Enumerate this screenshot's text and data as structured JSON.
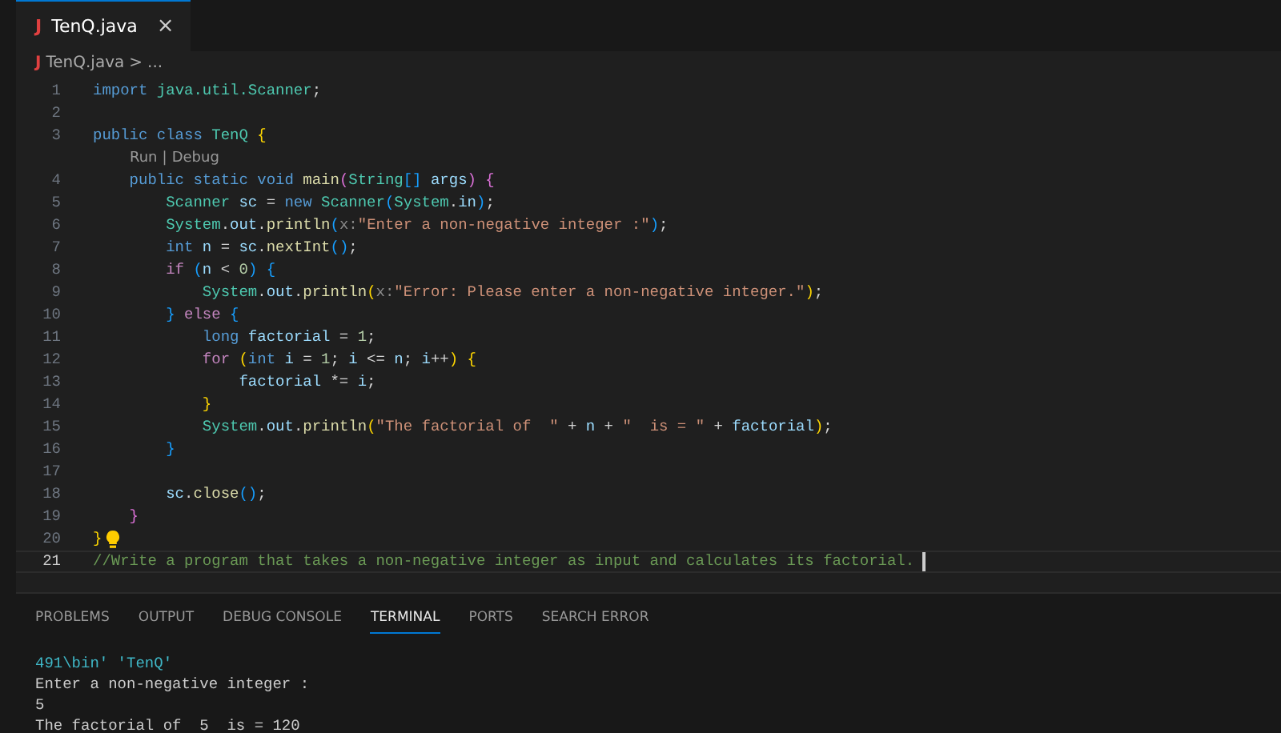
{
  "editor_tabs": [
    {
      "label": "TenQ.java",
      "icon": "J",
      "close": "×",
      "selected": true
    }
  ],
  "breadcrumb": {
    "icon": "J",
    "file": "TenQ.java",
    "separator": ">",
    "rest": "..."
  },
  "lines": [
    {
      "kind": "code",
      "number": "1",
      "current": false,
      "tokens": [
        {
          "text": "import ",
          "kind": "kw"
        },
        {
          "text": "java.util.Scanner",
          "kind": "type"
        },
        {
          "text": ";",
          "kind": "p"
        }
      ]
    },
    {
      "kind": "code",
      "number": "2",
      "current": false
    },
    {
      "kind": "code",
      "number": "3",
      "current": false,
      "tokens": [
        {
          "text": "public class ",
          "kind": "kw"
        },
        {
          "text": "TenQ ",
          "kind": "type"
        },
        {
          "text": "{",
          "kind": "b1"
        }
      ]
    },
    {
      "kind": "codelens",
      "links": [
        "Run",
        "Debug"
      ],
      "separator": "|"
    },
    {
      "kind": "code",
      "number": "4",
      "current": false,
      "tokens": [
        {
          "text": "    public static void ",
          "kind": "kw"
        },
        {
          "text": "main",
          "kind": "fn"
        },
        {
          "text": "(",
          "kind": "b2"
        },
        {
          "text": "String",
          "kind": "type"
        },
        {
          "text": "[] ",
          "kind": "b3"
        },
        {
          "text": "args",
          "kind": "var"
        },
        {
          "text": ") {",
          "kind": "b2"
        }
      ]
    },
    {
      "kind": "code",
      "number": "5",
      "current": false,
      "tokens": [
        {
          "text": "        Scanner ",
          "kind": "type"
        },
        {
          "text": "sc",
          "kind": "var"
        },
        {
          "text": " = ",
          "kind": "p"
        },
        {
          "text": "new ",
          "kind": "kw"
        },
        {
          "text": "Scanner",
          "kind": "type"
        },
        {
          "text": "(",
          "kind": "b3"
        },
        {
          "text": "System",
          "kind": "type"
        },
        {
          "text": ".",
          "kind": "p"
        },
        {
          "text": "in",
          "kind": "var"
        },
        {
          "text": ")",
          "kind": "b3"
        },
        {
          "text": ";",
          "kind": "p"
        }
      ]
    },
    {
      "kind": "code",
      "number": "6",
      "current": false,
      "tokens": [
        {
          "text": "        System",
          "kind": "type"
        },
        {
          "text": ".",
          "kind": "p"
        },
        {
          "text": "out",
          "kind": "var"
        },
        {
          "text": ".",
          "kind": "p"
        },
        {
          "text": "println",
          "kind": "fn"
        },
        {
          "text": "(",
          "kind": "b3"
        },
        {
          "text": "x:",
          "kind": "hint"
        },
        {
          "text": "\"Enter a non-negative integer :\"",
          "kind": "str"
        },
        {
          "text": ")",
          "kind": "b3"
        },
        {
          "text": ";",
          "kind": "p"
        }
      ]
    },
    {
      "kind": "code",
      "number": "7",
      "current": false,
      "tokens": [
        {
          "text": "        int ",
          "kind": "kw"
        },
        {
          "text": "n",
          "kind": "var"
        },
        {
          "text": " = ",
          "kind": "p"
        },
        {
          "text": "sc",
          "kind": "var"
        },
        {
          "text": ".",
          "kind": "p"
        },
        {
          "text": "nextInt",
          "kind": "fn"
        },
        {
          "text": "()",
          "kind": "b3"
        },
        {
          "text": ";",
          "kind": "p"
        }
      ]
    },
    {
      "kind": "code",
      "number": "8",
      "current": false,
      "tokens": [
        {
          "text": "        if ",
          "kind": "ctl"
        },
        {
          "text": "(",
          "kind": "b3"
        },
        {
          "text": "n",
          "kind": "var"
        },
        {
          "text": " < ",
          "kind": "p"
        },
        {
          "text": "0",
          "kind": "num"
        },
        {
          "text": ") {",
          "kind": "b3"
        }
      ]
    },
    {
      "kind": "code",
      "number": "9",
      "current": false,
      "tokens": [
        {
          "text": "            System",
          "kind": "type"
        },
        {
          "text": ".",
          "kind": "p"
        },
        {
          "text": "out",
          "kind": "var"
        },
        {
          "text": ".",
          "kind": "p"
        },
        {
          "text": "println",
          "kind": "fn"
        },
        {
          "text": "(",
          "kind": "b1"
        },
        {
          "text": "x:",
          "kind": "hint"
        },
        {
          "text": "\"Error: Please enter a non-negative integer.\"",
          "kind": "str"
        },
        {
          "text": ")",
          "kind": "b1"
        },
        {
          "text": ";",
          "kind": "p"
        }
      ]
    },
    {
      "kind": "code",
      "number": "10",
      "current": false,
      "tokens": [
        {
          "text": "        } ",
          "kind": "b3"
        },
        {
          "text": "else ",
          "kind": "ctl"
        },
        {
          "text": "{",
          "kind": "b3"
        }
      ]
    },
    {
      "kind": "code",
      "number": "11",
      "current": false,
      "tokens": [
        {
          "text": "            long ",
          "kind": "kw"
        },
        {
          "text": "factorial",
          "kind": "var"
        },
        {
          "text": " = ",
          "kind": "p"
        },
        {
          "text": "1",
          "kind": "num"
        },
        {
          "text": ";",
          "kind": "p"
        }
      ]
    },
    {
      "kind": "code",
      "number": "12",
      "current": false,
      "tokens": [
        {
          "text": "            for ",
          "kind": "ctl"
        },
        {
          "text": "(",
          "kind": "b1"
        },
        {
          "text": "int ",
          "kind": "kw"
        },
        {
          "text": "i",
          "kind": "var"
        },
        {
          "text": " = ",
          "kind": "p"
        },
        {
          "text": "1",
          "kind": "num"
        },
        {
          "text": "; ",
          "kind": "p"
        },
        {
          "text": "i",
          "kind": "var"
        },
        {
          "text": " <= ",
          "kind": "p"
        },
        {
          "text": "n",
          "kind": "var"
        },
        {
          "text": "; ",
          "kind": "p"
        },
        {
          "text": "i",
          "kind": "var"
        },
        {
          "text": "++",
          "kind": "p"
        },
        {
          "text": ") {",
          "kind": "b1"
        }
      ]
    },
    {
      "kind": "code",
      "number": "13",
      "current": false,
      "tokens": [
        {
          "text": "                factorial",
          "kind": "var"
        },
        {
          "text": " *= ",
          "kind": "p"
        },
        {
          "text": "i",
          "kind": "var"
        },
        {
          "text": ";",
          "kind": "p"
        }
      ]
    },
    {
      "kind": "code",
      "number": "14",
      "current": false,
      "tokens": [
        {
          "text": "            }",
          "kind": "b1"
        }
      ]
    },
    {
      "kind": "code",
      "number": "15",
      "current": false,
      "tokens": [
        {
          "text": "            System",
          "kind": "type"
        },
        {
          "text": ".",
          "kind": "p"
        },
        {
          "text": "out",
          "kind": "var"
        },
        {
          "text": ".",
          "kind": "p"
        },
        {
          "text": "println",
          "kind": "fn"
        },
        {
          "text": "(",
          "kind": "b1"
        },
        {
          "text": "\"The factorial of  \"",
          "kind": "str"
        },
        {
          "text": " + ",
          "kind": "p"
        },
        {
          "text": "n",
          "kind": "var"
        },
        {
          "text": " + ",
          "kind": "p"
        },
        {
          "text": "\"  is = \"",
          "kind": "str"
        },
        {
          "text": " + ",
          "kind": "p"
        },
        {
          "text": "factorial",
          "kind": "var"
        },
        {
          "text": ")",
          "kind": "b1"
        },
        {
          "text": ";",
          "kind": "p"
        }
      ]
    },
    {
      "kind": "code",
      "number": "16",
      "current": false,
      "tokens": [
        {
          "text": "        }",
          "kind": "b3"
        }
      ]
    },
    {
      "kind": "code",
      "number": "17",
      "current": false
    },
    {
      "kind": "code",
      "number": "18",
      "current": false,
      "tokens": [
        {
          "text": "        sc",
          "kind": "var"
        },
        {
          "text": ".",
          "kind": "p"
        },
        {
          "text": "close",
          "kind": "fn"
        },
        {
          "text": "()",
          "kind": "b3"
        },
        {
          "text": ";",
          "kind": "p"
        }
      ]
    },
    {
      "kind": "code",
      "number": "19",
      "current": false,
      "tokens": [
        {
          "text": "    }",
          "kind": "b2"
        }
      ]
    },
    {
      "kind": "code",
      "number": "20",
      "current": false,
      "lightbulb": true,
      "tokens": [
        {
          "text": "}",
          "kind": "b1"
        }
      ]
    },
    {
      "kind": "code",
      "number": "21",
      "current": true,
      "tokens": [
        {
          "text": "//Write a program that takes a non-negative integer as input and calculates its factorial.",
          "kind": "cmt"
        }
      ]
    }
  ],
  "panel_tabs": [
    {
      "label": "PROBLEMS",
      "selected": false
    },
    {
      "label": "OUTPUT",
      "selected": false
    },
    {
      "label": "DEBUG CONSOLE",
      "selected": false
    },
    {
      "label": "TERMINAL",
      "selected": true
    },
    {
      "label": "PORTS",
      "selected": false
    },
    {
      "label": "SEARCH ERROR",
      "selected": false
    }
  ],
  "terminal": [
    {
      "kind": "command",
      "text": "491\\bin' 'TenQ'"
    },
    {
      "kind": "output",
      "text": "Enter a non-negative integer :"
    },
    {
      "kind": "output",
      "text": "5"
    },
    {
      "kind": "output",
      "text": "The factorial of  5  is = 120"
    }
  ]
}
